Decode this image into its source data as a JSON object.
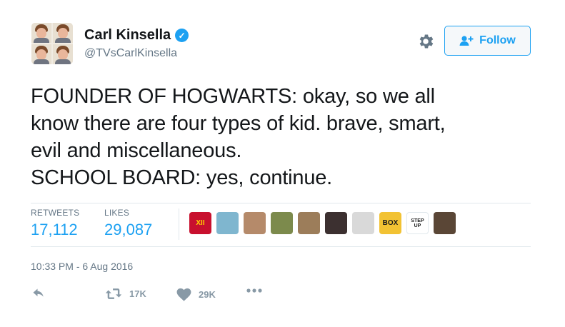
{
  "author": {
    "name": "Carl Kinsella",
    "handle": "@TVsCarlKinsella",
    "verified_glyph": "✓"
  },
  "header": {
    "follow_label": "Follow",
    "settings_icon": "gear-icon"
  },
  "tweet": {
    "lines": [
      "FOUNDER OF HOGWARTS: okay, so we all",
      "know there are four types of kid. brave, smart,",
      "evil and miscellaneous.",
      "SCHOOL BOARD: yes, continue."
    ]
  },
  "stats": {
    "retweets_label": "RETWEETS",
    "retweets_value": "17,112",
    "likes_label": "LIKES",
    "likes_value": "29,087"
  },
  "likers": [
    {
      "text": "XII",
      "color": "#c8102e",
      "text_color": "#ffd200"
    },
    {
      "text": "",
      "color": "#7fb6cf",
      "text_color": "#ffffff"
    },
    {
      "text": "",
      "color": "#b58a6a",
      "text_color": "#ffffff"
    },
    {
      "text": "",
      "color": "#7c8a4c",
      "text_color": "#ffffff"
    },
    {
      "text": "",
      "color": "#9c7d5a",
      "text_color": "#ffffff"
    },
    {
      "text": "",
      "color": "#3c3030",
      "text_color": "#ffffff"
    },
    {
      "text": "",
      "color": "#d9d9d9",
      "text_color": "#ffffff"
    },
    {
      "text": "BOX",
      "color": "#f2c233",
      "text_color": "#1a1a1a"
    },
    {
      "text": "STEP UP",
      "color": "#ffffff",
      "text_color": "#1a1a1a"
    },
    {
      "text": "",
      "color": "#5a4636",
      "text_color": "#ffffff"
    }
  ],
  "timestamp": "10:33 PM - 6 Aug 2016",
  "actions": {
    "retweet_count": "17K",
    "like_count": "29K"
  },
  "colors": {
    "accent": "#1da1f2",
    "muted": "#657786",
    "divider": "#e1e8ed"
  }
}
